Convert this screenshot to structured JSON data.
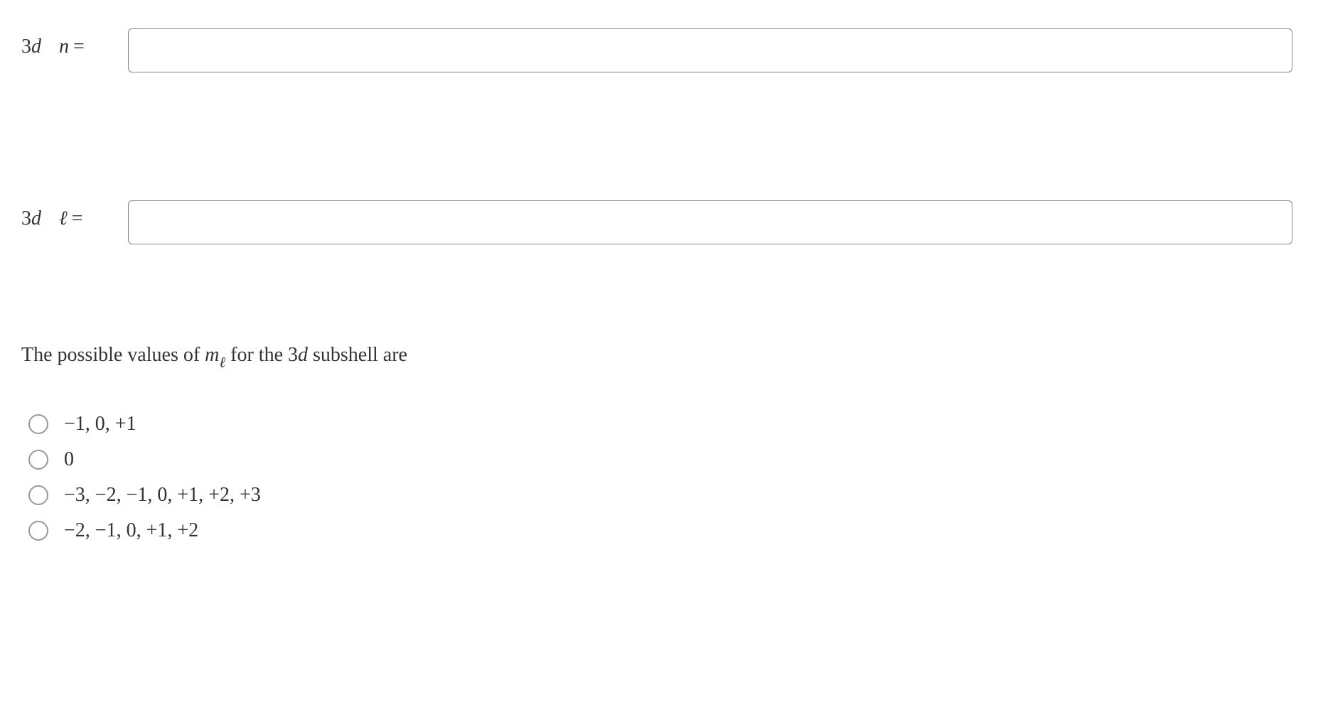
{
  "inputs": [
    {
      "subshell_num": "3",
      "subshell_letter": "d",
      "variable": "n",
      "equals": "=",
      "value": ""
    },
    {
      "subshell_num": "3",
      "subshell_letter": "d",
      "variable": "ℓ",
      "equals": "=",
      "value": ""
    }
  ],
  "question": {
    "prefix": "The possible values of ",
    "m": "m",
    "sub": "ℓ",
    "mid": " for the 3",
    "d": "d",
    "suffix": " subshell are"
  },
  "options": [
    "−1, 0, +1",
    "0",
    "−3, −2, −1, 0, +1, +2, +3",
    "−2, −1, 0, +1, +2"
  ]
}
